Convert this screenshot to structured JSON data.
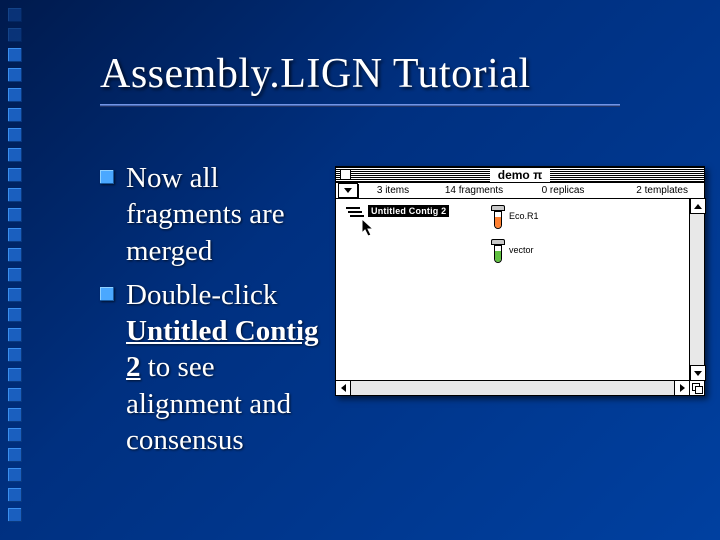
{
  "slide": {
    "title": "Assembly.LIGN Tutorial",
    "bullets": [
      {
        "text": "Now all fragments are merged",
        "emphasis": null
      },
      {
        "text_before": "Double-click ",
        "emphasis": "Untitled Contig 2",
        "text_after": " to see alignment and consensus"
      }
    ]
  },
  "window": {
    "title": "demo π",
    "status": {
      "items": "3 items",
      "fragments": "14 fragments",
      "replicas": "0 replicas",
      "templates": "2 templates"
    },
    "items": {
      "contig": {
        "label": "Untitled Contig 2"
      },
      "tubes": [
        {
          "id": "eco",
          "label": "Eco.R1",
          "color": "#ff8030"
        },
        {
          "id": "vec",
          "label": "vector",
          "color": "#60c040"
        }
      ]
    }
  }
}
